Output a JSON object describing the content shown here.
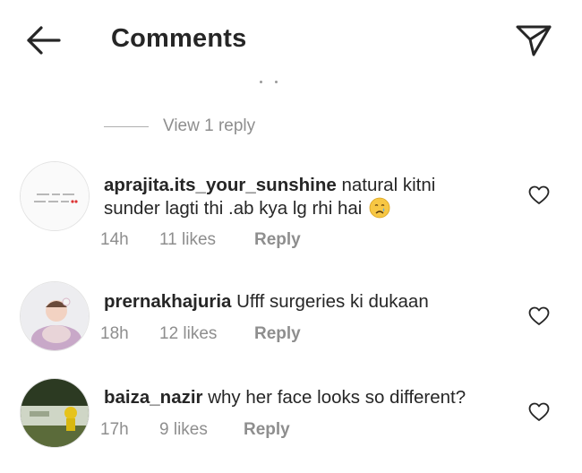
{
  "header": {
    "title": "Comments"
  },
  "thread": {
    "view_replies_label": "View 1 reply"
  },
  "comments": [
    {
      "username": "aprajita.its_your_sunshine",
      "text_line1": " natural kitni",
      "text_line2": "sunder lagti thi .ab kya  lg rhi hai",
      "time": "14h",
      "likes": "11 likes",
      "reply_label": "Reply"
    },
    {
      "username": "prernakhajuria",
      "text_line1": " Ufff surgeries ki dukaan",
      "time": "18h",
      "likes": "12 likes",
      "reply_label": "Reply"
    },
    {
      "username": "baiza_nazir",
      "text_line1": " why her face looks so different?",
      "time": "17h",
      "likes": "9 likes",
      "reply_label": "Reply"
    }
  ]
}
